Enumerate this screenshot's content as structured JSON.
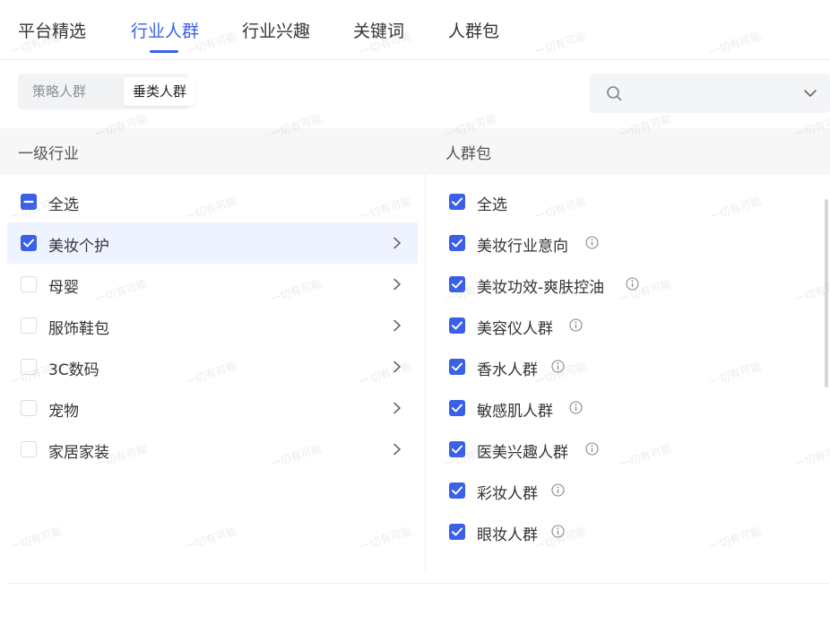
{
  "tabs": [
    {
      "label": "平台精选"
    },
    {
      "label": "行业人群",
      "active": true
    },
    {
      "label": "行业兴趣"
    },
    {
      "label": "关键词"
    },
    {
      "label": "人群包"
    }
  ],
  "segment": {
    "options": [
      "策略人群",
      "垂类人群"
    ],
    "selected": "垂类人群"
  },
  "search": {
    "placeholder": "",
    "value": "",
    "icon": "search-icon",
    "dropdown_icon": "chevron-down-icon"
  },
  "left": {
    "title": "一级行业",
    "select_all": {
      "label": "全选",
      "state": "partial"
    },
    "items": [
      {
        "label": "美妆个护",
        "checked": true,
        "selected": true
      },
      {
        "label": "母婴",
        "checked": false
      },
      {
        "label": "服饰鞋包",
        "checked": false
      },
      {
        "label": "3C数码",
        "checked": false
      },
      {
        "label": "宠物",
        "checked": false
      },
      {
        "label": "家居家装",
        "checked": false
      }
    ]
  },
  "right": {
    "title": "人群包",
    "select_all": {
      "label": "全选",
      "state": "checked"
    },
    "items": [
      {
        "label": "美妆行业意向",
        "checked": true
      },
      {
        "label": "美妆功效-爽肤控油",
        "checked": true
      },
      {
        "label": "美容仪人群",
        "checked": true
      },
      {
        "label": "香水人群",
        "checked": true
      },
      {
        "label": "敏感肌人群",
        "checked": true
      },
      {
        "label": "医美兴趣人群",
        "checked": true
      },
      {
        "label": "彩妆人群",
        "checked": true
      },
      {
        "label": "眼妆人群",
        "checked": true
      }
    ]
  },
  "watermark": "一切有可能",
  "colors": {
    "accent": "#3a60e8",
    "selected_row_bg": "#eef3ff",
    "header_bg": "#f7f7f8"
  }
}
